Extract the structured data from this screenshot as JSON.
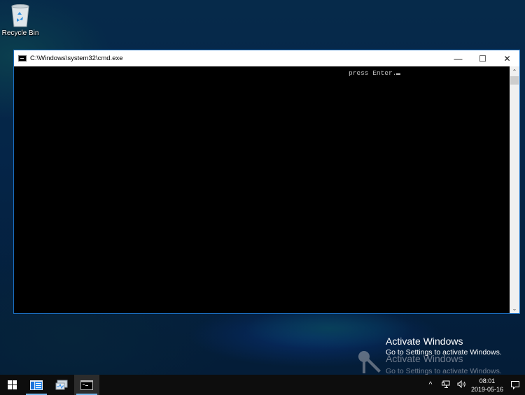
{
  "desktop": {
    "icons": [
      {
        "label": "Recycle Bin",
        "icon": "recycle-bin-icon"
      }
    ]
  },
  "window": {
    "title": "C:\\Windows\\system32\\cmd.exe",
    "controls": {
      "minimize": "—",
      "maximize": "☐",
      "close": "✕"
    },
    "console": {
      "text": "press Enter."
    },
    "scrollbar": {
      "up": "⌃",
      "down": "⌄"
    }
  },
  "watermark": {
    "title": "Activate Windows",
    "subtitle": "Go to Settings to activate Windows."
  },
  "taskbar": {
    "buttons": [
      {
        "name": "start",
        "icon": "windows-logo-icon"
      },
      {
        "name": "server-manager",
        "icon": "server-manager-icon"
      },
      {
        "name": "resource-monitor",
        "icon": "performance-icon"
      },
      {
        "name": "command-prompt",
        "icon": "cmd-icon"
      }
    ],
    "tray": {
      "show_hidden": "^",
      "network": "network-icon",
      "volume": "volume-icon",
      "time": "08:01",
      "date": "2019-05-16",
      "notifications": "action-center-icon"
    }
  }
}
